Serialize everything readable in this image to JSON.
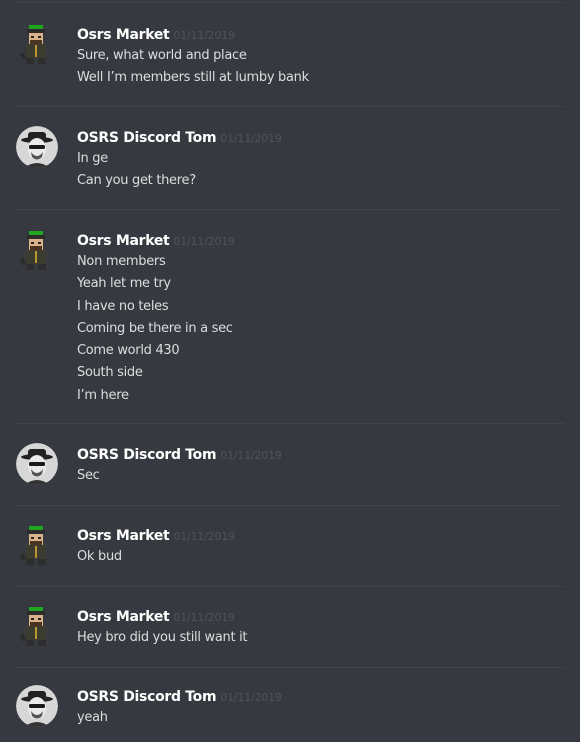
{
  "groups": [
    {
      "author": "Osrs Market",
      "avatar_icon": "green-haired-character-avatar-icon",
      "timestamp": "01/11/2019",
      "lines": [
        "Sure, what world and place",
        "Well I’m members still at lumby bank"
      ]
    },
    {
      "author": "OSRS Discord Tom",
      "avatar_icon": "hat-and-sunglasses-man-avatar-icon",
      "timestamp": "01/11/2019",
      "lines": [
        "In ge",
        "Can you get there?"
      ]
    },
    {
      "author": "Osrs Market",
      "avatar_icon": "green-haired-character-avatar-icon",
      "timestamp": "01/11/2019",
      "lines": [
        "Non members",
        "Yeah let me try",
        "I have no teles",
        "Coming be there in a sec",
        "Come world 430",
        "South side",
        "I’m here"
      ]
    },
    {
      "author": "OSRS Discord Tom",
      "avatar_icon": "hat-and-sunglasses-man-avatar-icon",
      "timestamp": "01/11/2019",
      "lines": [
        "Sec"
      ]
    },
    {
      "author": "Osrs Market",
      "avatar_icon": "green-haired-character-avatar-icon",
      "timestamp": "01/11/2019",
      "lines": [
        "Ok bud"
      ]
    },
    {
      "author": "Osrs Market",
      "avatar_icon": "green-haired-character-avatar-icon",
      "timestamp": "01/11/2019",
      "lines": [
        "Hey bro did you still want it"
      ]
    },
    {
      "author": "OSRS Discord Tom",
      "avatar_icon": "hat-and-sunglasses-man-avatar-icon",
      "timestamp": "01/11/2019",
      "lines": [
        "yeah"
      ]
    }
  ],
  "colors": {
    "background": "#36393f",
    "username": "#ffffff",
    "timestamp": "#4f535b",
    "message_text": "#dcddde",
    "divider": "#40434a"
  }
}
